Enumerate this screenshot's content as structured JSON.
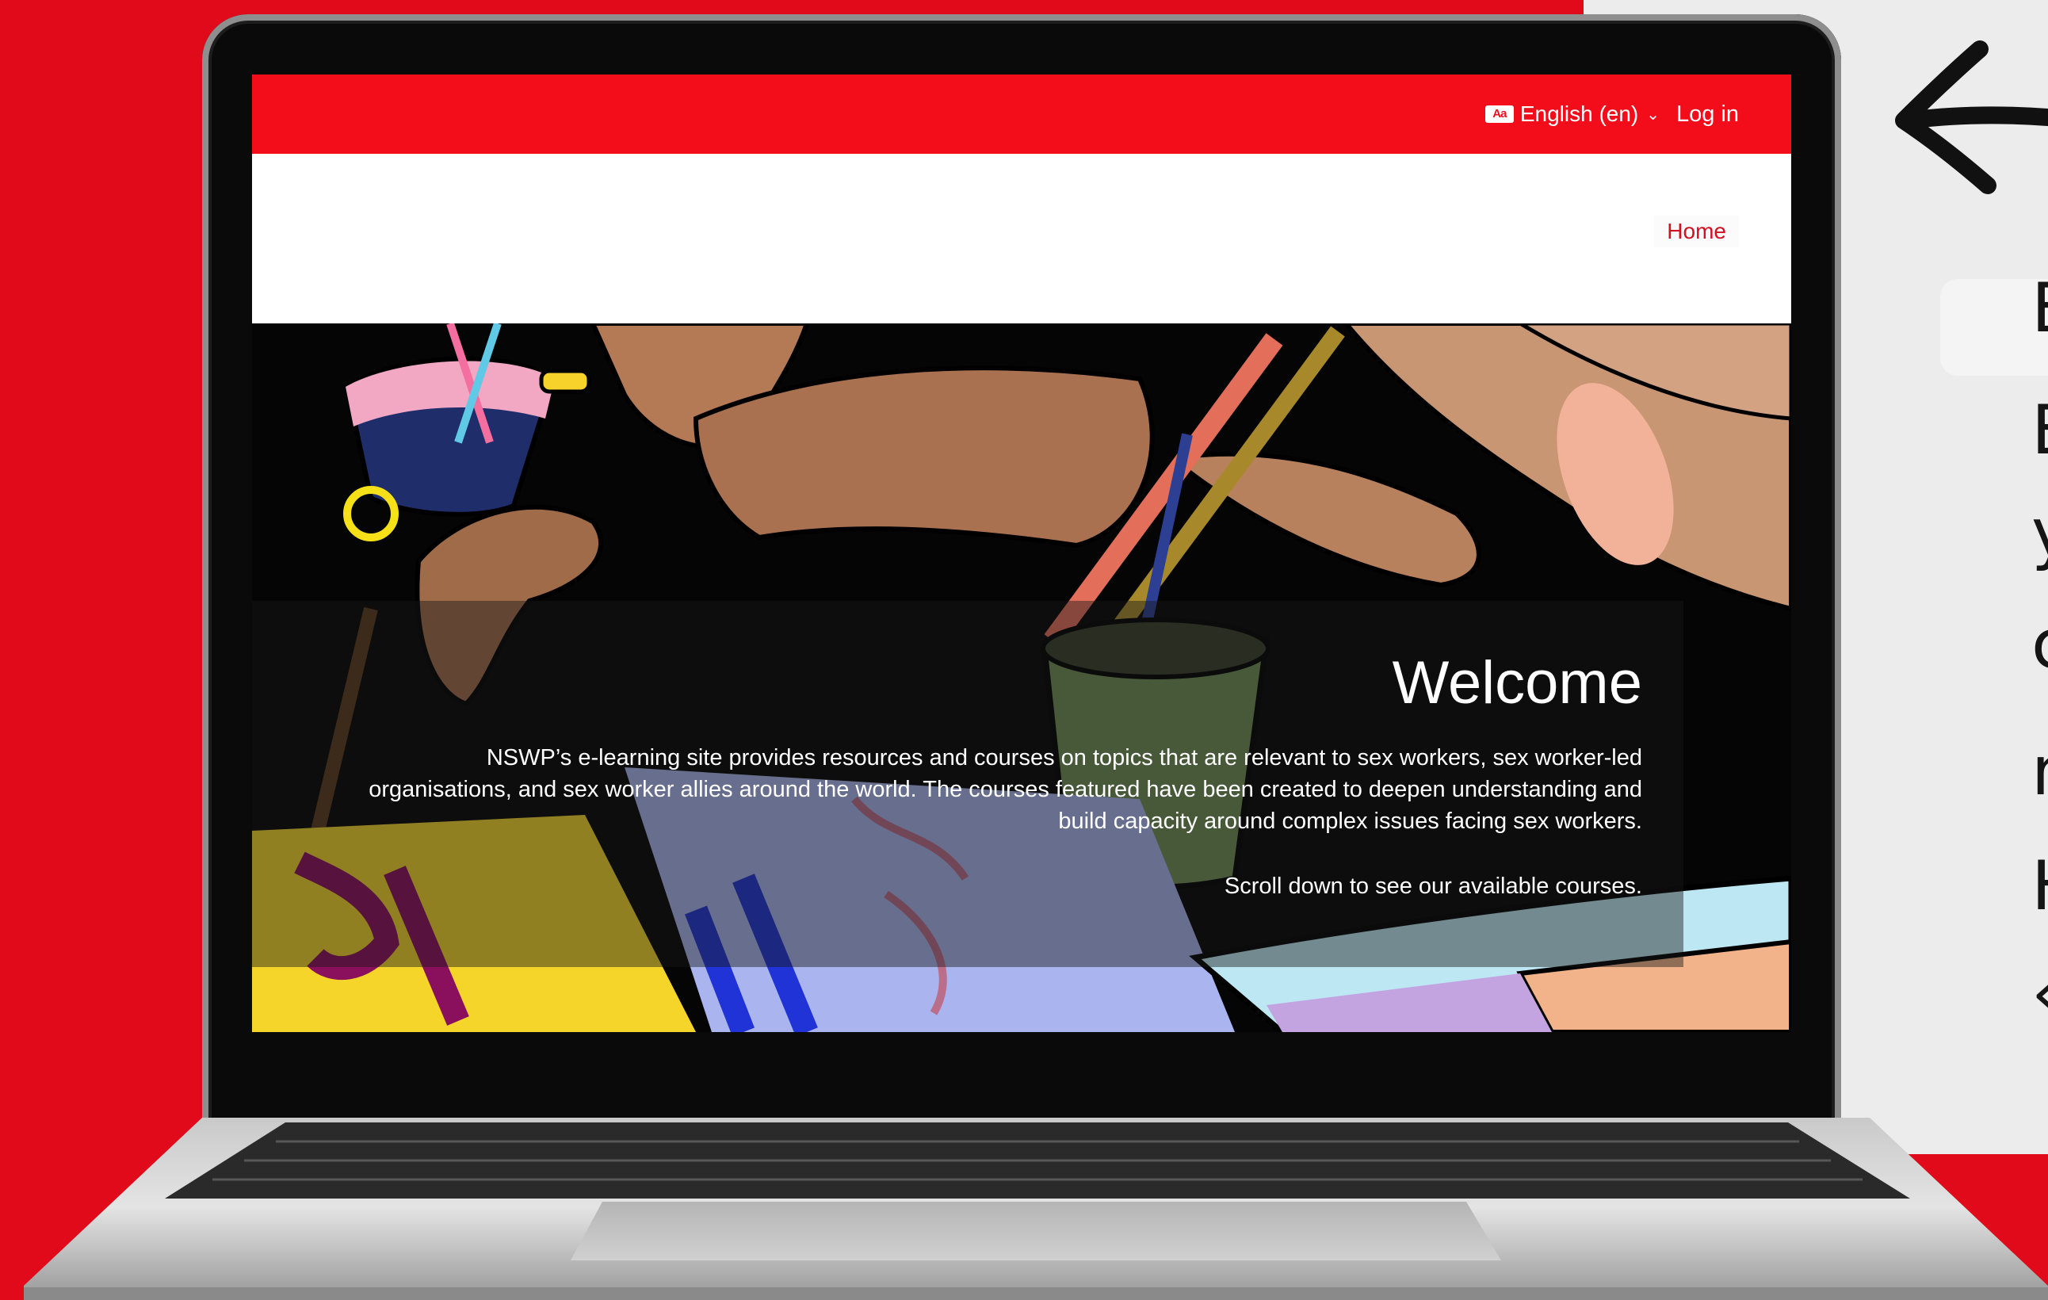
{
  "site": {
    "language_label": "English (en)",
    "language_icon": "Aa",
    "login_label": "Log in",
    "nav_home": "Home"
  },
  "hero": {
    "title": "Welcome",
    "intro": "NSWP’s e-learning site provides resources and courses on topics that are relevant to sex workers, sex worker-led organisations, and sex worker allies around the world. The courses featured have been created to deepen understanding and build capacity around complex issues facing sex workers.",
    "scroll_note": "Scroll down to see our available courses.",
    "sign_text": "JU"
  },
  "side_panel": {
    "lines": [
      "E",
      "E",
      "y",
      "c",
      "n",
      "H",
      "«"
    ]
  },
  "colors": {
    "brand_red": "#f30d1b",
    "background_red": "#e10a1a",
    "panel_gray": "#ececec"
  },
  "icons": {
    "arrow": "arrow-left-icon",
    "language": "language-icon",
    "chevron": "chevron-down-icon"
  }
}
